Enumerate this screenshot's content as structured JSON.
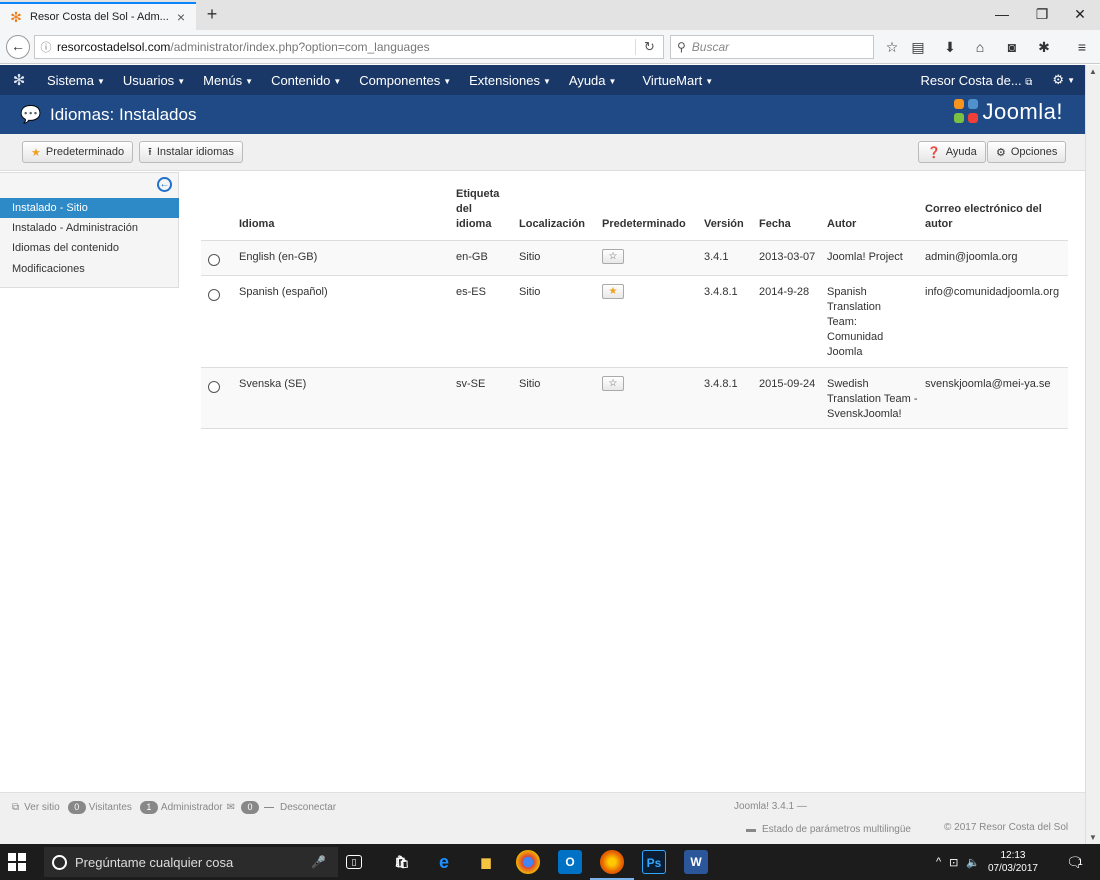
{
  "browser": {
    "tab_title": "Resor Costa del Sol - Adm...",
    "tab_close": "×",
    "new_tab": "+",
    "url_host": "resorcostadelsol.com",
    "url_path": "/administrator/index.php?option=com_languages",
    "search_placeholder": "Buscar"
  },
  "menu": {
    "items": [
      "Sistema",
      "Usuarios",
      "Menús",
      "Contenido",
      "Componentes",
      "Extensiones",
      "Ayuda",
      "VirtueMart"
    ],
    "site_link": "Resor Costa de...",
    "settings_icon": "gear-icon"
  },
  "header": {
    "title": "Idiomas: Instalados",
    "brand": "Joomla!"
  },
  "toolbar": {
    "default_label": "Predeterminado",
    "install_label": "Instalar idiomas",
    "help_label": "Ayuda",
    "options_label": "Opciones"
  },
  "sidebar": {
    "items": [
      "Instalado - Sitio",
      "Instalado - Administración",
      "Idiomas del contenido",
      "Modificaciones"
    ],
    "active_index": 0
  },
  "table": {
    "headers": {
      "language": "Idioma",
      "tag": "Etiqueta del idioma",
      "location": "Localización",
      "default": "Predeterminado",
      "version": "Versión",
      "date": "Fecha",
      "author": "Autor",
      "email": "Correo electrónico del autor"
    },
    "rows": [
      {
        "language": "English (en-GB)",
        "tag": "en-GB",
        "location": "Sitio",
        "is_default": false,
        "version": "3.4.1",
        "date": "2013-03-07",
        "author": "Joomla! Project",
        "email": "admin@joomla.org"
      },
      {
        "language": "Spanish (español)",
        "tag": "es-ES",
        "location": "Sitio",
        "is_default": true,
        "version": "3.4.8.1",
        "date": "2014-9-28",
        "author": "Spanish Translation Team: Comunidad Joomla",
        "email": "info@comunidadjoomla.org"
      },
      {
        "language": "Svenska (SE)",
        "tag": "sv-SE",
        "location": "Sitio",
        "is_default": false,
        "version": "3.4.8.1",
        "date": "2015-09-24",
        "author": "Swedish Translation Team - SvenskJoomla!",
        "email": "svenskjoomla@mei-ya.se"
      }
    ]
  },
  "status": {
    "view_site": "Ver sitio",
    "visitors_count": "0",
    "visitors_label": "Visitantes",
    "admin_count": "1",
    "admin_label": "Administrador",
    "messages_count": "0",
    "logout_label": "Desconectar",
    "version": "Joomla! 3.4.1 —",
    "multilang": "Estado de parámetros multilingüe",
    "copyright": "© 2017 Resor Costa del Sol"
  },
  "taskbar": {
    "search_placeholder": "Pregúntame cualquier cosa",
    "time": "12:13",
    "date": "07/03/2017",
    "notifications": "1"
  }
}
